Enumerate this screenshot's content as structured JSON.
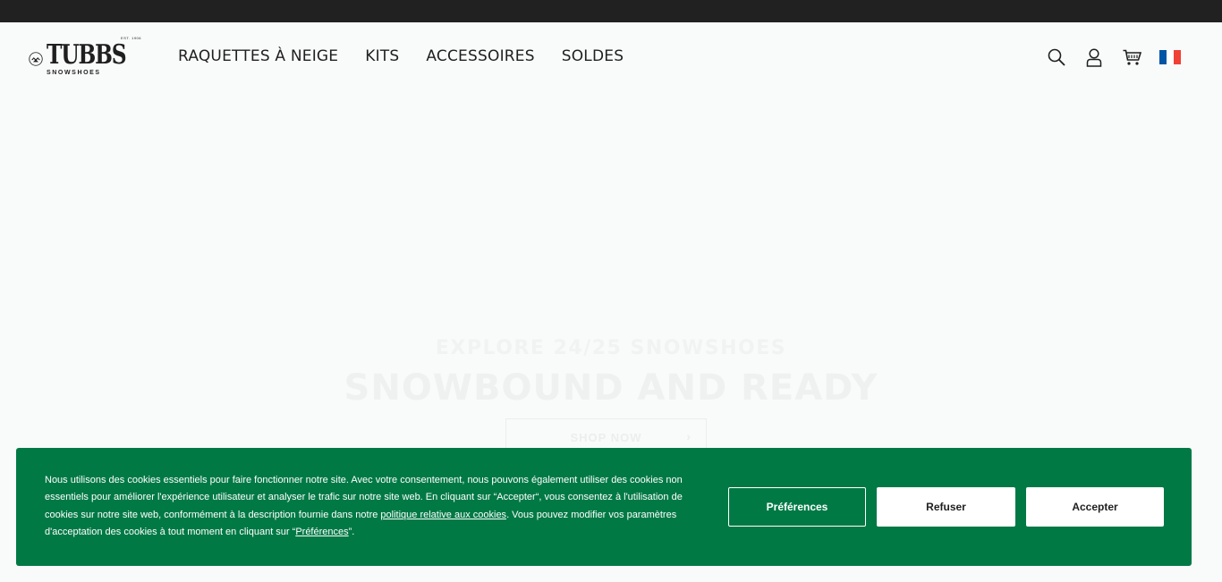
{
  "header": {
    "logo": {
      "est": "EST. 1906",
      "brand": "TUBBS",
      "sub": "SNOWSHOES"
    },
    "nav": [
      "RAQUETTES À NEIGE",
      "KITS",
      "ACCESSOIRES",
      "SOLDES"
    ],
    "icons": [
      "search-icon",
      "account-icon",
      "cart-icon",
      "flag-fr-icon"
    ],
    "flag_colors": [
      "#0055a4",
      "#ffffff",
      "#ef4135"
    ]
  },
  "hero": {
    "kicker": "EXPLORE 24/25 SNOWSHOES",
    "title": "SNOWBOUND AND READY",
    "button": "SHOP NOW",
    "button_arrow": "›"
  },
  "cookie": {
    "text_before_link": "Nous utilisons des cookies essentiels pour faire fonctionner notre site. Avec votre consentement, nous pouvons également utiliser des cookies non essentiels pour améliorer l'expérience utilisateur et analyser le trafic sur notre site web. En cliquant sur “Accepter“, vous consentez à l'utilisation de cookies sur notre site web, conformément à la description fournie dans notre ",
    "policy_link": "politique relative aux cookies",
    "text_middle": ". Vous pouvez modifier vos paramètres d'acceptation des cookies à tout moment en cliquant sur “",
    "preferences_link": "Préférences",
    "text_end": "”.",
    "buttons": {
      "preferences": "Préférences",
      "refuse": "Refuser",
      "accept": "Accepter"
    },
    "background": "#017945"
  }
}
